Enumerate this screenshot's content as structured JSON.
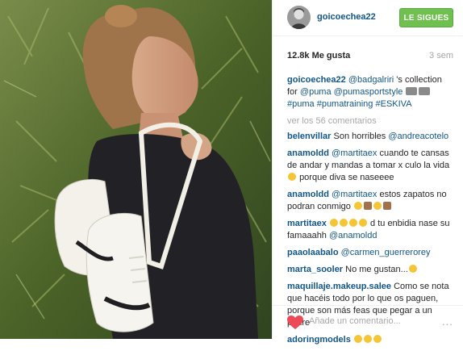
{
  "post": {
    "username": "goicoechea22",
    "follow_label": "LE SIGUES",
    "likes": "12.8k Me gusta",
    "time": "3 sem",
    "caption": {
      "user": "goicoechea22",
      "parts": [
        "@badgalriri",
        " 's collection for ",
        "@puma",
        " ",
        "@pumasportstyle",
        " ",
        "",
        " ",
        "#puma",
        " ",
        "#pumatraining",
        " ",
        "#ESKIVA"
      ]
    },
    "view_more": "ver los 56 comentarios",
    "add_comment_placeholder": "Añade un comentario...",
    "more_label": "..."
  },
  "comments": [
    {
      "user": "belenvillar",
      "pre": "Son horribles ",
      "mention": "@andreacotelo",
      "post": ""
    },
    {
      "user": "anamoldd",
      "pre": "",
      "mention": "@martitaex",
      "post": " cuando te cansas de andar y mandas a tomar x culo la vida"
    },
    {
      "user": "",
      "pre": "porque diva se naseeee",
      "mention": "",
      "post": ""
    },
    {
      "user": "anamoldd",
      "pre": "",
      "mention": "@martitaex",
      "post": " estos zapatos no podran conmigo"
    },
    {
      "user": "martitaex",
      "pre": "",
      "mention": "",
      "post": " d tu enbidia nase su famaaahh "
    },
    {
      "user": "paaolaabalo",
      "pre": "",
      "mention": "@carmen_guerrerorey",
      "post": ""
    },
    {
      "user": "marta_sooler",
      "pre": "No me gustan...",
      "mention": "",
      "post": ""
    },
    {
      "user": "maquillaje.makeup.salee",
      "pre": "Como se nota que hacéis todo por lo que os paguen, porque son más feas que pegar a un padre",
      "mention": "",
      "post": ""
    },
    {
      "user": "adoringmodels",
      "pre": "",
      "mention": "",
      "post": ""
    }
  ],
  "martitaex_mention": "@anamoldd",
  "colors": {
    "link": "#125688",
    "follow_bg": "#70c050",
    "muted": "#a5a7aa",
    "heart": "#ed4956"
  },
  "icons": [
    "heart-icon",
    "more-options-icon",
    "emoji-icon"
  ]
}
